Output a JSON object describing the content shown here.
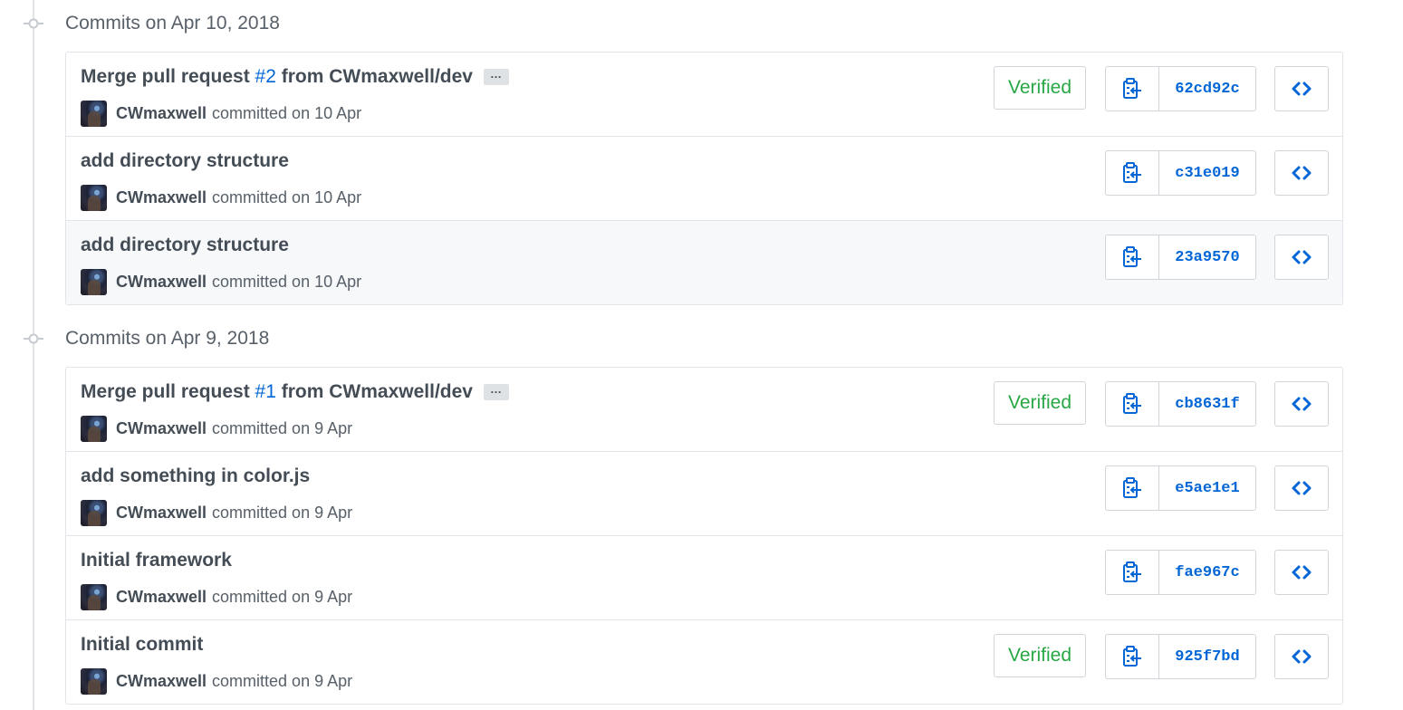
{
  "groups": [
    {
      "title": "Commits on Apr 10, 2018",
      "commits": [
        {
          "message_prefix": "Merge pull request ",
          "pr_link": "#2",
          "message_suffix": " from CWmaxwell/dev",
          "has_ellipsis": true,
          "ellipsis": "…",
          "author": "CWmaxwell",
          "committed": "committed on 10 Apr",
          "verified": "Verified",
          "sha": "62cd92c"
        },
        {
          "message_prefix": "add directory structure",
          "pr_link": "",
          "message_suffix": "",
          "has_ellipsis": false,
          "author": "CWmaxwell",
          "committed": "committed on 10 Apr",
          "verified": "",
          "sha": "c31e019"
        },
        {
          "message_prefix": "add directory structure",
          "pr_link": "",
          "message_suffix": "",
          "has_ellipsis": false,
          "author": "CWmaxwell",
          "committed": "committed on 10 Apr",
          "verified": "",
          "sha": "23a9570"
        }
      ]
    },
    {
      "title": "Commits on Apr 9, 2018",
      "commits": [
        {
          "message_prefix": "Merge pull request ",
          "pr_link": "#1",
          "message_suffix": " from CWmaxwell/dev",
          "has_ellipsis": true,
          "ellipsis": "…",
          "author": "CWmaxwell",
          "committed": "committed on 9 Apr",
          "verified": "Verified",
          "sha": "cb8631f"
        },
        {
          "message_prefix": "add something in color.js",
          "pr_link": "",
          "message_suffix": "",
          "has_ellipsis": false,
          "author": "CWmaxwell",
          "committed": "committed on 9 Apr",
          "verified": "",
          "sha": "e5ae1e1"
        },
        {
          "message_prefix": "Initial framework",
          "pr_link": "",
          "message_suffix": "",
          "has_ellipsis": false,
          "author": "CWmaxwell",
          "committed": "committed on 9 Apr",
          "verified": "",
          "sha": "fae967c"
        },
        {
          "message_prefix": "Initial commit",
          "pr_link": "",
          "message_suffix": "",
          "has_ellipsis": false,
          "author": "CWmaxwell",
          "committed": "committed on 9 Apr",
          "verified": "Verified",
          "sha": "925f7bd"
        }
      ]
    }
  ],
  "icons": {
    "commit": "git-commit-icon",
    "copy": "clipboard-copy-icon",
    "browse": "code-icon"
  },
  "colors": {
    "link": "#0366d6",
    "verified": "#28a745",
    "border": "#d1d5da",
    "muted": "#586069"
  }
}
